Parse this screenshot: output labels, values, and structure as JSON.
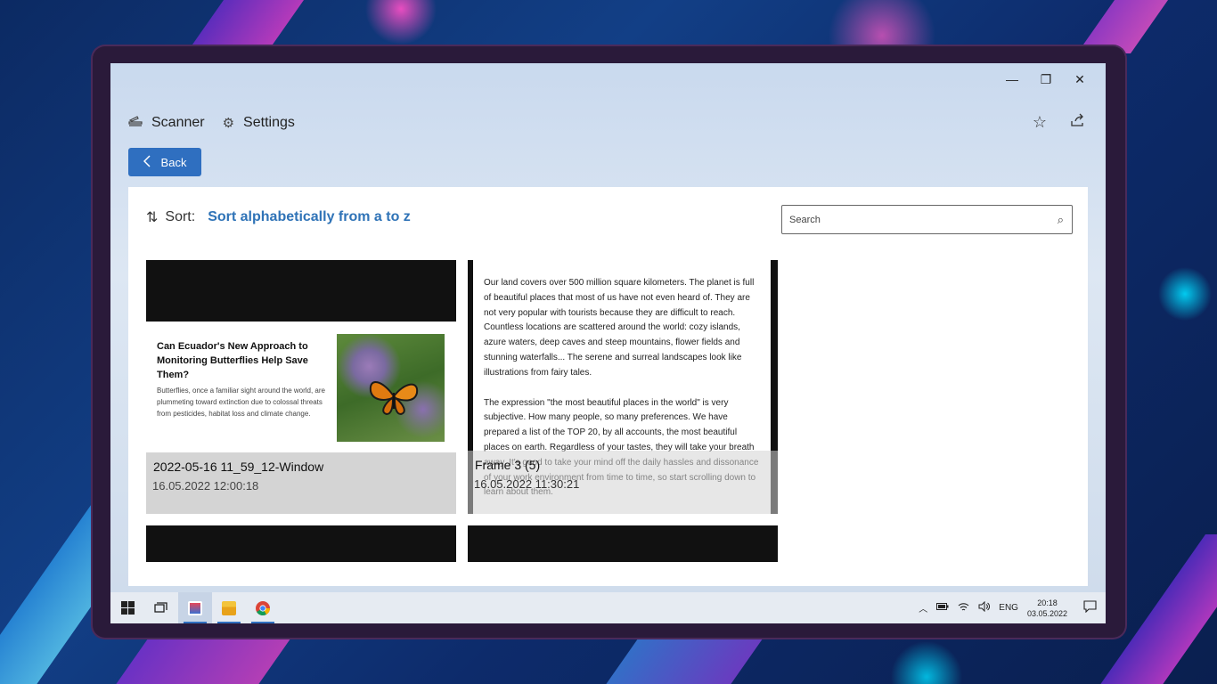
{
  "window": {
    "minimize_label": "—",
    "restore_label": "❐",
    "close_label": "✕"
  },
  "nav": {
    "scanner_label": "Scanner",
    "settings_label": "Settings"
  },
  "toolbar": {
    "back_label": "Back"
  },
  "sort": {
    "label": "Sort:",
    "value": "Sort alphabetically from a to z"
  },
  "search": {
    "placeholder": "Search"
  },
  "items": [
    {
      "name": "2022-05-16 11_59_12-Window",
      "date": "16.05.2022 12:00:18",
      "thumb_title": "Can Ecuador's New Approach to Monitoring Butterflies Help Save Them?",
      "thumb_text": "Butterflies, once a familiar sight around the world, are plummeting toward extinction due to colossal threats from pesticides, habitat loss and climate change."
    },
    {
      "name": "Frame 3 (5)",
      "date": "16.05.2022 11:30:21",
      "thumb_p1": "Our land covers over 500 million square kilometers. The planet is full of beautiful places that most of us have not even heard of. They are not very popular with tourists because they are difficult to reach. Countless locations are scattered around the world: cozy islands, azure waters, deep caves and steep mountains, flower fields and stunning waterfalls... The serene and surreal landscapes look like illustrations from fairy tales.",
      "thumb_p2": "The expression \"the most beautiful places in the world\" is very subjective. How many people, so many preferences. We have prepared a list of the TOP 20, by all accounts, the most beautiful places on earth. Regardless of your tastes, they will take your breath away. It's good to take your mind off the daily hassles and dissonance of your work environment from time to time, so start scrolling down to learn about them."
    }
  ],
  "taskbar": {
    "language": "ENG",
    "time": "20:18",
    "date": "03.05.2022"
  }
}
